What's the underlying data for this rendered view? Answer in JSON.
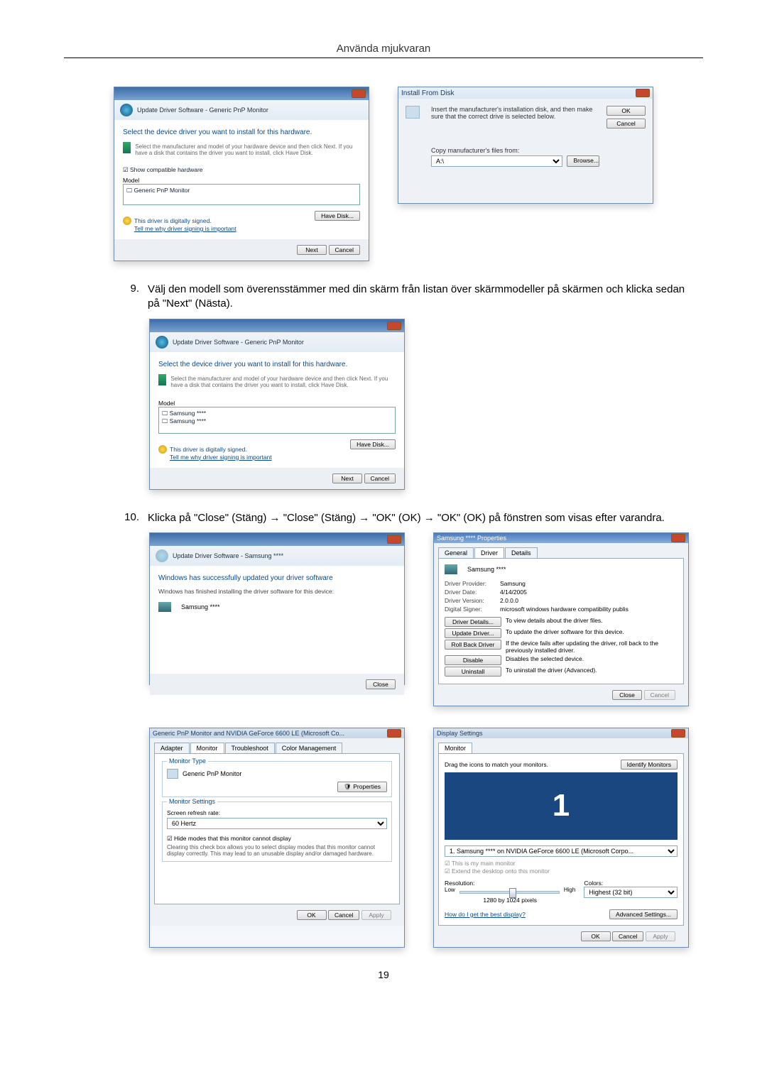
{
  "page": {
    "title": "Använda mjukvaran",
    "number": "19"
  },
  "steps": {
    "s9_num": "9.",
    "s9_text": "Välj den modell som överensstämmer med din skärm från listan över skärmmodeller på skärmen och klicka sedan på \"Next\" (Nästa).",
    "s10_num": "10.",
    "s10_text": "Klicka på \"Close\" (Stäng) → \"Close\" (Stäng) → \"OK\" (OK) → \"OK\" (OK) på fönstren som visas efter varandra."
  },
  "dlg_update1": {
    "crumb": "Update Driver Software - Generic PnP Monitor",
    "headline": "Select the device driver you want to install for this hardware.",
    "desc": "Select the manufacturer and model of your hardware device and then click Next. If you have a disk that contains the driver you want to install, click Have Disk.",
    "checkbox": "Show compatible hardware",
    "group_model": "Model",
    "item": "Generic PnP Monitor",
    "signed": "This driver is digitally signed.",
    "tell": "Tell me why driver signing is important",
    "have_disk": "Have Disk...",
    "next": "Next",
    "cancel": "Cancel"
  },
  "dlg_install_disk": {
    "title": "Install From Disk",
    "text": "Insert the manufacturer's installation disk, and then make sure that the correct drive is selected below.",
    "ok": "OK",
    "cancel": "Cancel",
    "copy_label": "Copy manufacturer's files from:",
    "path": "A:\\",
    "browse": "Browse..."
  },
  "dlg_update2": {
    "crumb": "Update Driver Software - Generic PnP Monitor",
    "headline": "Select the device driver you want to install for this hardware.",
    "desc": "Select the manufacturer and model of your hardware device and then click Next. If you have a disk that contains the driver you want to install, click Have Disk.",
    "group_model": "Model",
    "item1": "Samsung ****",
    "item2": "Samsung ****",
    "signed": "This driver is digitally signed.",
    "tell": "Tell me why driver signing is important",
    "have_disk": "Have Disk...",
    "next": "Next",
    "cancel": "Cancel"
  },
  "dlg_update3": {
    "crumb": "Update Driver Software - Samsung ****",
    "headline": "Windows has successfully updated your driver software",
    "desc": "Windows has finished installing the driver software for this device:",
    "item": "Samsung ****",
    "close": "Close"
  },
  "dlg_props": {
    "title": "Samsung **** Properties",
    "tab_general": "General",
    "tab_driver": "Driver",
    "tab_details": "Details",
    "device": "Samsung ****",
    "provider_l": "Driver Provider:",
    "provider_v": "Samsung",
    "date_l": "Driver Date:",
    "date_v": "4/14/2005",
    "version_l": "Driver Version:",
    "version_v": "2.0.0.0",
    "signer_l": "Digital Signer:",
    "signer_v": "microsoft windows hardware compatibility publis",
    "btn_details": "Driver Details...",
    "btn_details_desc": "To view details about the driver files.",
    "btn_update": "Update Driver...",
    "btn_update_desc": "To update the driver software for this device.",
    "btn_rollback": "Roll Back Driver",
    "btn_rollback_desc": "If the device fails after updating the driver, roll back to the previously installed driver.",
    "btn_disable": "Disable",
    "btn_disable_desc": "Disables the selected device.",
    "btn_uninstall": "Uninstall",
    "btn_uninstall_desc": "To uninstall the driver (Advanced).",
    "close": "Close",
    "cancel": "Cancel"
  },
  "dlg_monitor": {
    "title": "Generic PnP Monitor and NVIDIA GeForce 6600 LE (Microsoft Co...",
    "tab_adapter": "Adapter",
    "tab_monitor": "Monitor",
    "tab_trouble": "Troubleshoot",
    "tab_color": "Color Management",
    "group_type": "Monitor Type",
    "type_val": "Generic PnP Monitor",
    "properties_btn": "Properties",
    "group_settings": "Monitor Settings",
    "refresh_label": "Screen refresh rate:",
    "refresh_val": "60 Hertz",
    "hide_check": "Hide modes that this monitor cannot display",
    "hide_desc": "Clearing this check box allows you to select display modes that this monitor cannot display correctly. This may lead to an unusable display and/or damaged hardware.",
    "ok": "OK",
    "cancel": "Cancel",
    "apply": "Apply"
  },
  "dlg_display": {
    "title": "Display Settings",
    "tab_monitor": "Monitor",
    "drag_text": "Drag the icons to match your monitors.",
    "identify": "Identify Monitors",
    "monitor_num": "1",
    "selector": "1. Samsung **** on NVIDIA GeForce 6600 LE (Microsoft Corpo...",
    "main_check": "This is my main monitor",
    "extend_check": "Extend the desktop onto this monitor",
    "resolution_label": "Resolution:",
    "low": "Low",
    "high": "High",
    "res_val": "1280 by 1024 pixels",
    "colors_label": "Colors:",
    "colors_val": "Highest (32 bit)",
    "best_link": "How do I get the best display?",
    "advanced": "Advanced Settings...",
    "ok": "OK",
    "cancel": "Cancel",
    "apply": "Apply"
  }
}
